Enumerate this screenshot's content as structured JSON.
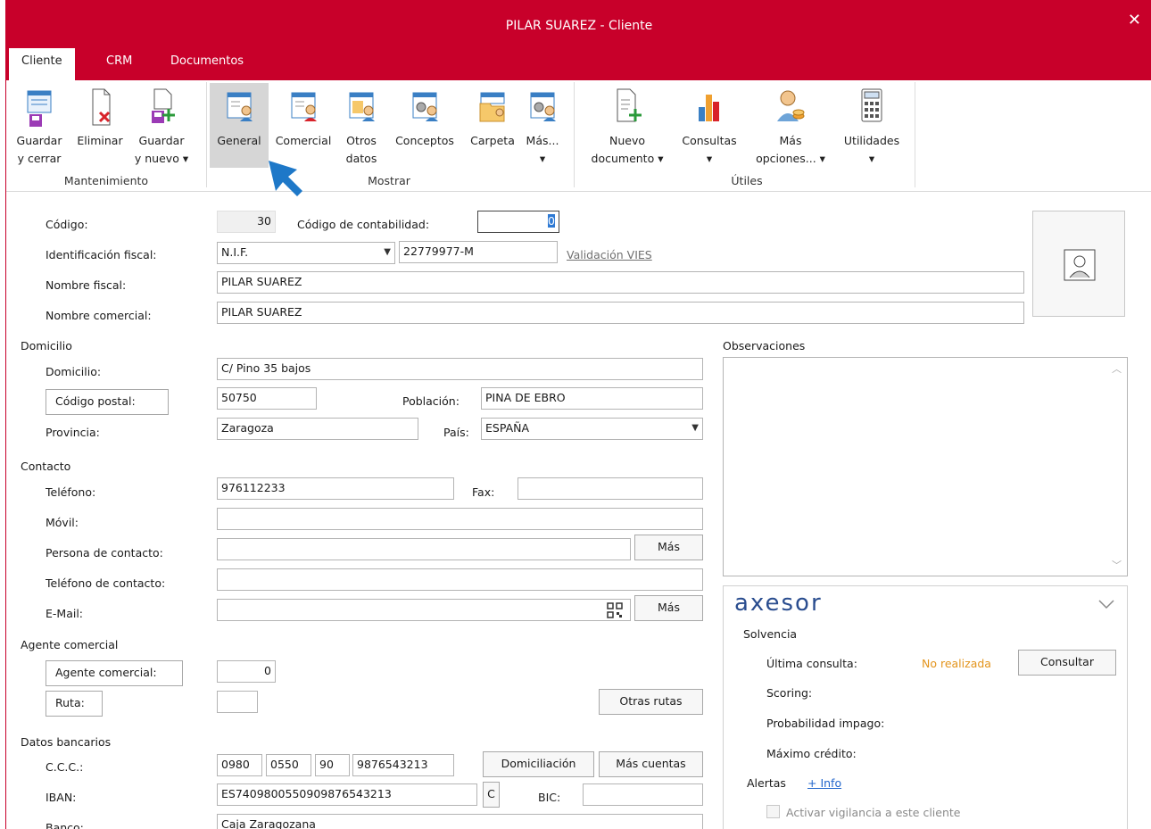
{
  "window": {
    "title": "PILAR SUAREZ - Cliente",
    "close": "✕"
  },
  "tabs": [
    {
      "label": "Cliente"
    },
    {
      "label": "CRM"
    },
    {
      "label": "Documentos"
    }
  ],
  "ribbon": {
    "groups": {
      "mantenimiento": "Mantenimiento",
      "mostrar": "Mostrar",
      "utiles": "Útiles"
    },
    "guardar_cerrar": [
      "Guardar",
      "y cerrar"
    ],
    "eliminar": "Eliminar",
    "guardar_nuevo": [
      "Guardar",
      "y nuevo ▾"
    ],
    "general": "General",
    "comercial": "Comercial",
    "otros_datos": [
      "Otros",
      "datos"
    ],
    "conceptos": "Conceptos",
    "carpeta": "Carpeta",
    "mas": [
      "Más...",
      "▾"
    ],
    "nuevo_documento": [
      "Nuevo",
      "documento ▾"
    ],
    "consultas": [
      "Consultas",
      "▾"
    ],
    "mas_opciones": [
      "Más",
      "opciones... ▾"
    ],
    "utilidades": [
      "Utilidades",
      "▾"
    ]
  },
  "form": {
    "codigo_label": "Código:",
    "codigo": "30",
    "codigo_contab_label": "Código de contabilidad:",
    "codigo_contab": "0",
    "id_fiscal_label": "Identificación fiscal:",
    "id_fiscal_tipo": "N.I.F.",
    "id_fiscal_valor": "22779977-M",
    "validacion_vies": "Validación VIES",
    "nombre_fiscal_label": "Nombre fiscal:",
    "nombre_fiscal": "PILAR SUAREZ",
    "nombre_comercial_label": "Nombre comercial:",
    "nombre_comercial": "PILAR SUAREZ",
    "domicilio_sec": "Domicilio",
    "domicilio_label": "Domicilio:",
    "domicilio": "C/ Pino 35 bajos",
    "cp_button": "Código postal:",
    "cp": "50750",
    "poblacion_label": "Población:",
    "poblacion": "PINA DE EBRO",
    "provincia_label": "Provincia:",
    "provincia": "Zaragoza",
    "pais_label": "País:",
    "pais": "ESPAÑA",
    "contacto_sec": "Contacto",
    "telefono_label": "Teléfono:",
    "telefono": "976112233",
    "fax_label": "Fax:",
    "fax": "",
    "movil_label": "Móvil:",
    "movil": "",
    "persona_label": "Persona de contacto:",
    "persona": "",
    "mas_label": "Más",
    "tel_contacto_label": "Teléfono de contacto:",
    "tel_contacto": "",
    "email_label": "E-Mail:",
    "email": "",
    "agente_sec": "Agente comercial",
    "agente_button": "Agente comercial:",
    "agente": "0",
    "ruta_button": "Ruta:",
    "ruta": "",
    "otras_rutas": "Otras rutas",
    "bancarios_sec": "Datos bancarios",
    "ccc_label": "C.C.C.:",
    "ccc": [
      "0980",
      "0550",
      "90",
      "9876543213"
    ],
    "domiciliacion": "Domiciliación",
    "mas_cuentas": "Más cuentas",
    "iban_label": "IBAN:",
    "iban": "ES7409800550909876543213",
    "iban_c": "C",
    "bic_label": "BIC:",
    "bic": "",
    "banco_label": "Banco:",
    "banco": "Caja Zaragozana"
  },
  "observaciones": {
    "label": "Observaciones",
    "text": ""
  },
  "axesor": {
    "logo": "axesor",
    "solvencia": "Solvencia",
    "ultima_label": "Última consulta:",
    "ultima_value": "No realizada",
    "consultar": "Consultar",
    "scoring": "Scoring:",
    "probabilidad": "Probabilidad impago:",
    "maximo": "Máximo crédito:",
    "alertas": "Alertas",
    "info": "+ Info",
    "vigilancia": "Activar vigilancia a este cliente"
  },
  "colors": {
    "brand": "#c8002a",
    "accent_orange": "#e3941c",
    "link_blue": "#2266cc",
    "axesor_blue": "#2a4d8f",
    "axesor_red": "#d8232a",
    "arrow": "#1e78c8"
  }
}
